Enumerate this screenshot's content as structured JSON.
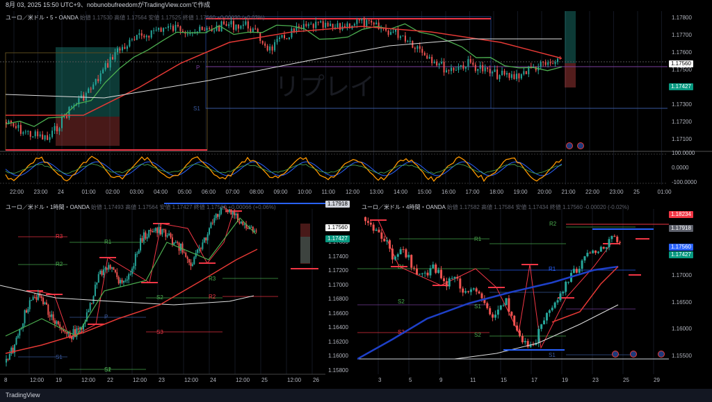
{
  "header": {
    "info": "8月 03, 2025 15:50 UTC+9、nobunobufreedomがTradingView.comで作成"
  },
  "panel_top": {
    "symbol": "ユーロ／米ドル・5・OANDA",
    "ohlc": "始値 1.17530 高値 1.17564 安値 1.17525 終値 1.17560 +0.00030 (+0.03%)",
    "price_ticks": [
      "1.17800",
      "1.17700",
      "1.17600",
      "1.17500",
      "1.17400",
      "1.17300",
      "1.17200",
      "1.17100"
    ],
    "last_price": "1.17560",
    "tag2": "1.17427",
    "osc_ticks": [
      "100.0000",
      "0.0000",
      "-100.0000"
    ],
    "time_ticks": [
      "22:00",
      "23:00",
      "24",
      "01:00",
      "02:00",
      "03:00",
      "04:00",
      "05:00",
      "06:00",
      "07:00",
      "08:00",
      "09:00",
      "10:00",
      "11:00",
      "12:00",
      "13:00",
      "14:00",
      "15:00",
      "16:00",
      "17:00",
      "18:00",
      "19:00",
      "20:00",
      "21:00",
      "22:00",
      "23:00",
      "25",
      "01:00"
    ],
    "pivot_labels": {
      "p": "P",
      "s1": "S1"
    },
    "watermark": "リプレイ"
  },
  "panel_bl": {
    "symbol": "ユーロ／米ドル・1時間・OANDA",
    "ohlc": "始値 1.17493 高値 1.17564 安値 1.17427 終値 1.17560 +0.00066 (+0.06%)",
    "price_ticks": [
      "1.17918",
      "1.17600",
      "1.17400",
      "1.17200",
      "1.17000",
      "1.16800",
      "1.16600",
      "1.16400",
      "1.16200",
      "1.16000",
      "1.15800"
    ],
    "last_price": "1.17560",
    "tag2": "1.17427",
    "hi_tag": "1.17918",
    "pivot_labels": [
      "R3",
      "R2",
      "R1",
      "P",
      "S1",
      "S2",
      "S3",
      "R3",
      "R2",
      "S1",
      "S2"
    ],
    "time_ticks": [
      "8",
      "12:00",
      "19",
      "12:00",
      "22",
      "12:00",
      "23",
      "12:00",
      "24",
      "12:00",
      "25",
      "12:00",
      "26"
    ]
  },
  "panel_br": {
    "symbol": "ユーロ／米ドル・4時間・OANDA",
    "ohlc": "始値 1.17582 高値 1.17584 安値 1.17434 終値 1.17560 -0.00020 (-0.02%)",
    "price_ticks": [
      "1.18234",
      "1.17918",
      "1.17500",
      "1.17000",
      "1.16500",
      "1.16000",
      "1.15500"
    ],
    "last_price": "1.17560",
    "tag2": "1.17427",
    "red_tag": "1.18234",
    "gray_tag": "1.17918",
    "pivot_labels": [
      "R2",
      "R1",
      "R1",
      "P",
      "S1",
      "S2",
      "S2",
      "S3",
      "S1",
      "S1"
    ],
    "time_ticks": [
      "3",
      "5",
      "9",
      "11",
      "15",
      "17",
      "19",
      "23",
      "25",
      "29"
    ]
  },
  "footer": {
    "brand": "TradingView"
  },
  "colors": {
    "up": "#26a69a",
    "down": "#ef5350",
    "accent": "#2962ff",
    "orange": "#ff9800"
  }
}
